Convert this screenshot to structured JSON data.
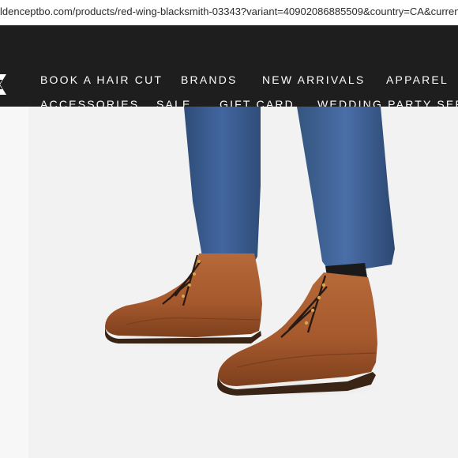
{
  "browser": {
    "url": "ldenceptbo.com/products/red-wing-blacksmith-03343?variant=40902086885509&country=CA&currency=CAD&utm"
  },
  "nav": {
    "items": [
      {
        "label": "BOOK A HAIR CUT"
      },
      {
        "label": "BRANDS"
      },
      {
        "label": "NEW ARRIVALS"
      },
      {
        "label": "APPAREL"
      },
      {
        "label": "ACCESSORIES"
      },
      {
        "label": "SALE"
      },
      {
        "label": "GIFT CARD"
      },
      {
        "label": "WEDDING PARTY SERVI"
      }
    ]
  },
  "colors": {
    "nav_background": "#1e1e1e",
    "nav_text": "#ffffff",
    "hero_background": "#f2f2f2",
    "trouser_blue": "#3d5f8f",
    "boot_leather": "#a4582c"
  }
}
